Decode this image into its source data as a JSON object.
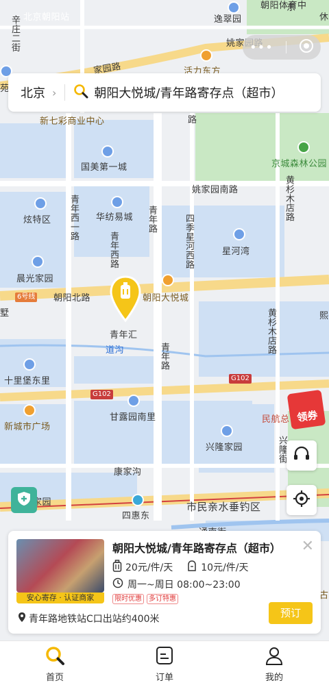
{
  "status_bar": {
    "carrier_text": "北京朝阳站"
  },
  "map": {
    "labels": {
      "xinnian_road": "辛庄二街",
      "yicui": "逸翠园",
      "yaojia_road": "姚家园路",
      "jia_road": "家园路",
      "huoli": "活力东方",
      "yuan": "苑",
      "xinqicai": "新七彩商业中心",
      "road_main_v": "路",
      "guomei": "国美第一城",
      "jingcheng": "京城森林公园",
      "yaojia_south": "姚家园南路",
      "huangshan_mu": "黄杉木店路",
      "xuante": "炫特区",
      "qingnian_xi_yi": "青年西一路",
      "huafang": "华纺易城",
      "qingnian_road_top": "青年路",
      "siji_xinghe": "四季星河西路",
      "xinghewan": "星河湾",
      "chenguang": "晨光家园",
      "qingnian_xi": "青年西路",
      "line6": "6号线",
      "chaoyang_bei": "朝阳北路",
      "chaoyang_joy": "朝阳大悦城",
      "shu": "墅",
      "xi": "熙",
      "qingnianhui": "青年汇",
      "daogou": "道沟",
      "huangshan_mu2": "黄杉木店路",
      "qingnian_road2": "青年路",
      "shilipu": "十里堡东里",
      "g102_a": "G102",
      "g102_b": "G102",
      "ganlu": "甘露园南里",
      "xinchengshi": "新城市广场",
      "minhang": "民航总",
      "xinglong": "兴隆家园",
      "xinglong_jie": "兴隆街",
      "kangjiagou": "康家沟",
      "jiayuan": "家园",
      "sihuidong": "四惠东",
      "shimin": "市民亲水垂钓区",
      "tongnan": "通南街",
      "gu": "古",
      "top_xiu": "休",
      "top_park": "朝阳体育中",
      "top_hao": "东"
    },
    "red_packet_label": "领券",
    "pin_color": "#f5c518",
    "road_color": "#f7d98a"
  },
  "search": {
    "city": "北京",
    "query": "朝阳大悦城/青年路寄存点（超市）"
  },
  "card": {
    "title": "朝阳大悦城/青年路寄存点（超市）",
    "badge": "安心寄存 · 认证商家",
    "price_large": "20元/件/天",
    "price_small": "10元/件/天",
    "hours": "周一~周日 08:00~23:00",
    "tags": [
      "限时优惠",
      "多订特惠"
    ],
    "book_label": "预订",
    "distance": "青年路地铁站C口出站约400米"
  },
  "tabbar": {
    "tabs": [
      {
        "label": "首页",
        "icon": "search-icon"
      },
      {
        "label": "订单",
        "icon": "order-icon"
      },
      {
        "label": "我的",
        "icon": "profile-icon"
      }
    ]
  }
}
